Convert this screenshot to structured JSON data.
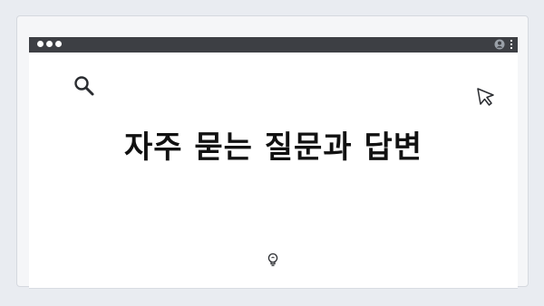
{
  "window": {
    "title_bar_color": "#3d3f44",
    "controls": [
      "dot",
      "dot",
      "dot"
    ],
    "right_icons": [
      "user-icon",
      "kebab-menu-icon"
    ]
  },
  "page": {
    "headline": "자주 묻는 질문과 답변"
  },
  "decorations": {
    "top_dots_count": 4,
    "icons": [
      "search-icon",
      "cursor-arrow-icon",
      "lightbulb-icon"
    ]
  },
  "colors": {
    "background": "#e9ecf1",
    "content": "#ffffff",
    "text": "#111111"
  }
}
